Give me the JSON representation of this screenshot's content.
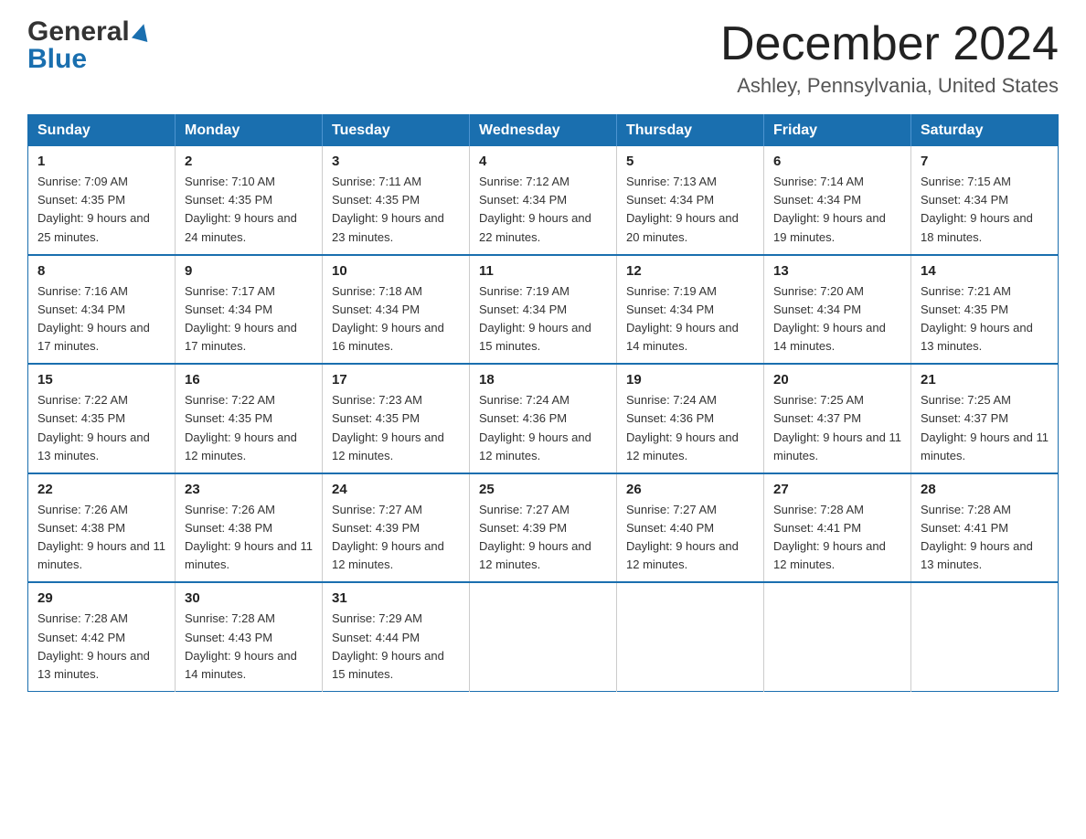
{
  "header": {
    "logo_general": "General",
    "logo_blue": "Blue",
    "title": "December 2024",
    "subtitle": "Ashley, Pennsylvania, United States"
  },
  "days_of_week": [
    "Sunday",
    "Monday",
    "Tuesday",
    "Wednesday",
    "Thursday",
    "Friday",
    "Saturday"
  ],
  "weeks": [
    [
      {
        "day": "1",
        "sunrise": "Sunrise: 7:09 AM",
        "sunset": "Sunset: 4:35 PM",
        "daylight": "Daylight: 9 hours and 25 minutes."
      },
      {
        "day": "2",
        "sunrise": "Sunrise: 7:10 AM",
        "sunset": "Sunset: 4:35 PM",
        "daylight": "Daylight: 9 hours and 24 minutes."
      },
      {
        "day": "3",
        "sunrise": "Sunrise: 7:11 AM",
        "sunset": "Sunset: 4:35 PM",
        "daylight": "Daylight: 9 hours and 23 minutes."
      },
      {
        "day": "4",
        "sunrise": "Sunrise: 7:12 AM",
        "sunset": "Sunset: 4:34 PM",
        "daylight": "Daylight: 9 hours and 22 minutes."
      },
      {
        "day": "5",
        "sunrise": "Sunrise: 7:13 AM",
        "sunset": "Sunset: 4:34 PM",
        "daylight": "Daylight: 9 hours and 20 minutes."
      },
      {
        "day": "6",
        "sunrise": "Sunrise: 7:14 AM",
        "sunset": "Sunset: 4:34 PM",
        "daylight": "Daylight: 9 hours and 19 minutes."
      },
      {
        "day": "7",
        "sunrise": "Sunrise: 7:15 AM",
        "sunset": "Sunset: 4:34 PM",
        "daylight": "Daylight: 9 hours and 18 minutes."
      }
    ],
    [
      {
        "day": "8",
        "sunrise": "Sunrise: 7:16 AM",
        "sunset": "Sunset: 4:34 PM",
        "daylight": "Daylight: 9 hours and 17 minutes."
      },
      {
        "day": "9",
        "sunrise": "Sunrise: 7:17 AM",
        "sunset": "Sunset: 4:34 PM",
        "daylight": "Daylight: 9 hours and 17 minutes."
      },
      {
        "day": "10",
        "sunrise": "Sunrise: 7:18 AM",
        "sunset": "Sunset: 4:34 PM",
        "daylight": "Daylight: 9 hours and 16 minutes."
      },
      {
        "day": "11",
        "sunrise": "Sunrise: 7:19 AM",
        "sunset": "Sunset: 4:34 PM",
        "daylight": "Daylight: 9 hours and 15 minutes."
      },
      {
        "day": "12",
        "sunrise": "Sunrise: 7:19 AM",
        "sunset": "Sunset: 4:34 PM",
        "daylight": "Daylight: 9 hours and 14 minutes."
      },
      {
        "day": "13",
        "sunrise": "Sunrise: 7:20 AM",
        "sunset": "Sunset: 4:34 PM",
        "daylight": "Daylight: 9 hours and 14 minutes."
      },
      {
        "day": "14",
        "sunrise": "Sunrise: 7:21 AM",
        "sunset": "Sunset: 4:35 PM",
        "daylight": "Daylight: 9 hours and 13 minutes."
      }
    ],
    [
      {
        "day": "15",
        "sunrise": "Sunrise: 7:22 AM",
        "sunset": "Sunset: 4:35 PM",
        "daylight": "Daylight: 9 hours and 13 minutes."
      },
      {
        "day": "16",
        "sunrise": "Sunrise: 7:22 AM",
        "sunset": "Sunset: 4:35 PM",
        "daylight": "Daylight: 9 hours and 12 minutes."
      },
      {
        "day": "17",
        "sunrise": "Sunrise: 7:23 AM",
        "sunset": "Sunset: 4:35 PM",
        "daylight": "Daylight: 9 hours and 12 minutes."
      },
      {
        "day": "18",
        "sunrise": "Sunrise: 7:24 AM",
        "sunset": "Sunset: 4:36 PM",
        "daylight": "Daylight: 9 hours and 12 minutes."
      },
      {
        "day": "19",
        "sunrise": "Sunrise: 7:24 AM",
        "sunset": "Sunset: 4:36 PM",
        "daylight": "Daylight: 9 hours and 12 minutes."
      },
      {
        "day": "20",
        "sunrise": "Sunrise: 7:25 AM",
        "sunset": "Sunset: 4:37 PM",
        "daylight": "Daylight: 9 hours and 11 minutes."
      },
      {
        "day": "21",
        "sunrise": "Sunrise: 7:25 AM",
        "sunset": "Sunset: 4:37 PM",
        "daylight": "Daylight: 9 hours and 11 minutes."
      }
    ],
    [
      {
        "day": "22",
        "sunrise": "Sunrise: 7:26 AM",
        "sunset": "Sunset: 4:38 PM",
        "daylight": "Daylight: 9 hours and 11 minutes."
      },
      {
        "day": "23",
        "sunrise": "Sunrise: 7:26 AM",
        "sunset": "Sunset: 4:38 PM",
        "daylight": "Daylight: 9 hours and 11 minutes."
      },
      {
        "day": "24",
        "sunrise": "Sunrise: 7:27 AM",
        "sunset": "Sunset: 4:39 PM",
        "daylight": "Daylight: 9 hours and 12 minutes."
      },
      {
        "day": "25",
        "sunrise": "Sunrise: 7:27 AM",
        "sunset": "Sunset: 4:39 PM",
        "daylight": "Daylight: 9 hours and 12 minutes."
      },
      {
        "day": "26",
        "sunrise": "Sunrise: 7:27 AM",
        "sunset": "Sunset: 4:40 PM",
        "daylight": "Daylight: 9 hours and 12 minutes."
      },
      {
        "day": "27",
        "sunrise": "Sunrise: 7:28 AM",
        "sunset": "Sunset: 4:41 PM",
        "daylight": "Daylight: 9 hours and 12 minutes."
      },
      {
        "day": "28",
        "sunrise": "Sunrise: 7:28 AM",
        "sunset": "Sunset: 4:41 PM",
        "daylight": "Daylight: 9 hours and 13 minutes."
      }
    ],
    [
      {
        "day": "29",
        "sunrise": "Sunrise: 7:28 AM",
        "sunset": "Sunset: 4:42 PM",
        "daylight": "Daylight: 9 hours and 13 minutes."
      },
      {
        "day": "30",
        "sunrise": "Sunrise: 7:28 AM",
        "sunset": "Sunset: 4:43 PM",
        "daylight": "Daylight: 9 hours and 14 minutes."
      },
      {
        "day": "31",
        "sunrise": "Sunrise: 7:29 AM",
        "sunset": "Sunset: 4:44 PM",
        "daylight": "Daylight: 9 hours and 15 minutes."
      },
      {
        "day": "",
        "sunrise": "",
        "sunset": "",
        "daylight": ""
      },
      {
        "day": "",
        "sunrise": "",
        "sunset": "",
        "daylight": ""
      },
      {
        "day": "",
        "sunrise": "",
        "sunset": "",
        "daylight": ""
      },
      {
        "day": "",
        "sunrise": "",
        "sunset": "",
        "daylight": ""
      }
    ]
  ]
}
